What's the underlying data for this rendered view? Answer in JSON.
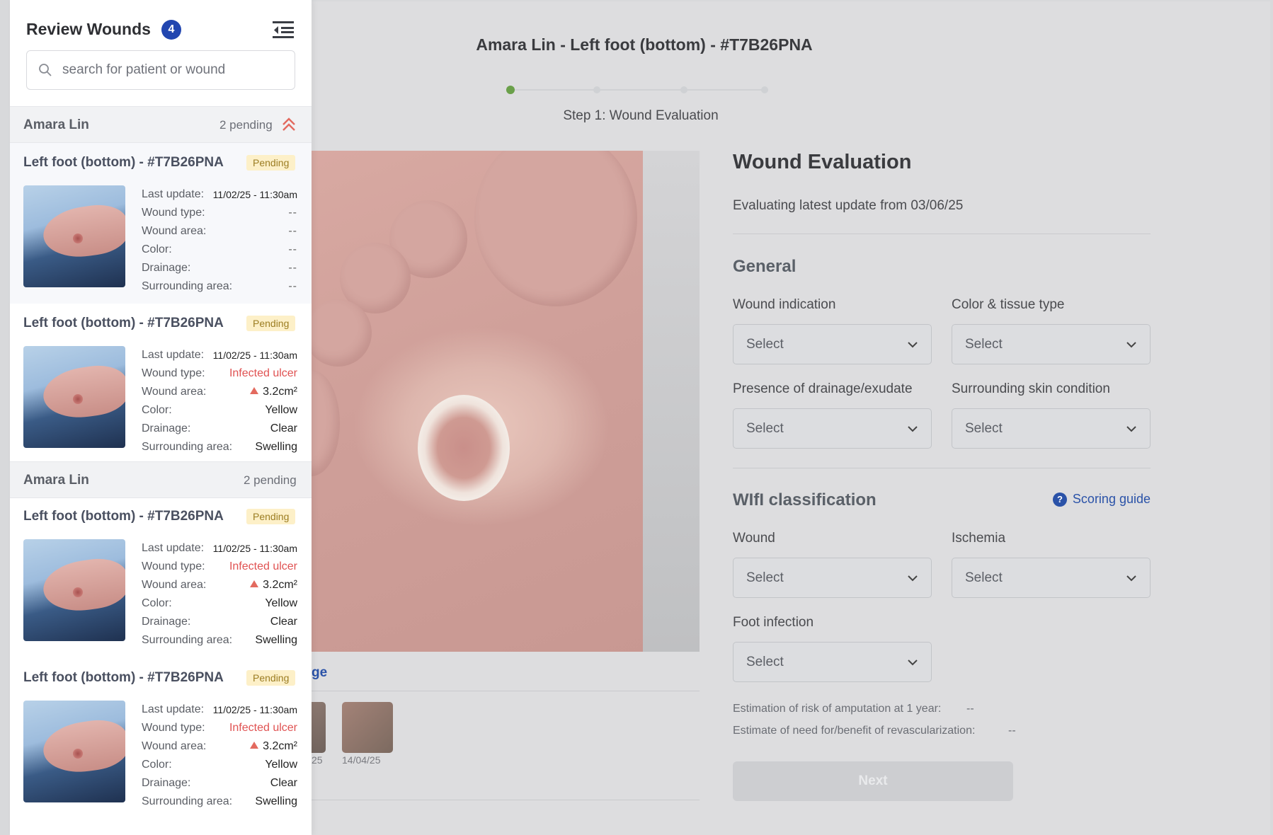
{
  "header": {
    "title": "Amara Lin - Left foot (bottom) - #T7B26PNA",
    "step_label": "Step 1: Wound Evaluation",
    "steps": 4,
    "active_step": 1
  },
  "gallery": {
    "link_text": "ge",
    "dates": [
      "25",
      "14/04/25"
    ]
  },
  "evaluation": {
    "title": "Wound Evaluation",
    "subtitle": "Evaluating latest update from 03/06/25",
    "general_title": "General",
    "wound_indication_label": "Wound indication",
    "color_tissue_label": "Color & tissue type",
    "drainage_label": "Presence of drainage/exudate",
    "surrounding_label": "Surrounding skin condition",
    "wifi_title": "WIfI classification",
    "scoring_guide": "Scoring guide",
    "wound_label": "Wound",
    "ischemia_label": "Ischemia",
    "foot_infection_label": "Foot infection",
    "select_placeholder": "Select",
    "risk_label": "Estimation of risk of amputation at 1 year:",
    "risk_value": "--",
    "revasc_label": "Estimate of need for/benefit of revascularization:",
    "revasc_value": "--",
    "next_label": "Next"
  },
  "sidebar": {
    "title": "Review Wounds",
    "count": "4",
    "search_placeholder": "search for patient or wound",
    "groups": [
      {
        "name": "Amara Lin",
        "pending": "2 pending"
      },
      {
        "name": "Amara Lin",
        "pending": "2 pending"
      }
    ],
    "field_labels": {
      "last_update": "Last update:",
      "wound_type": "Wound type:",
      "wound_area": "Wound area:",
      "color": "Color:",
      "drainage": "Drainage:",
      "surrounding": "Surrounding area:"
    },
    "items": [
      {
        "title": "Left foot (bottom) - #T7B26PNA",
        "badge": "Pending",
        "last_update": "11/02/25 - 11:30am",
        "wound_type": "--",
        "wound_area": "--",
        "color": "--",
        "drainage": "--",
        "surrounding": "--"
      },
      {
        "title": "Left foot (bottom) - #T7B26PNA",
        "badge": "Pending",
        "last_update": "11/02/25 - 11:30am",
        "wound_type": "Infected ulcer",
        "wound_area": "3.2cm²",
        "color": "Yellow",
        "drainage": "Clear",
        "surrounding": "Swelling"
      },
      {
        "title": "Left foot (bottom) - #T7B26PNA",
        "badge": "Pending",
        "last_update": "11/02/25 - 11:30am",
        "wound_type": "Infected ulcer",
        "wound_area": "3.2cm²",
        "color": "Yellow",
        "drainage": "Clear",
        "surrounding": "Swelling"
      },
      {
        "title": "Left foot (bottom) - #T7B26PNA",
        "badge": "Pending",
        "last_update": "11/02/25 - 11:30am",
        "wound_type": "Infected ulcer",
        "wound_area": "3.2cm²",
        "color": "Yellow",
        "drainage": "Clear",
        "surrounding": "Swelling"
      }
    ]
  },
  "colors": {
    "accent_blue": "#2246b0",
    "pending_bg": "#fdf0c8",
    "alert_red": "#e05252",
    "step_active": "#6aa04a"
  }
}
